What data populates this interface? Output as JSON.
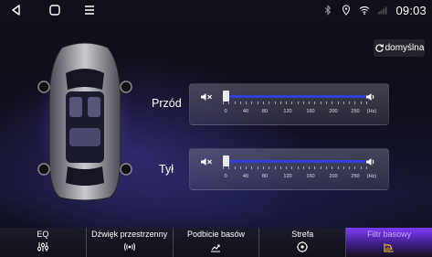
{
  "status_bar": {
    "nav": {
      "back_icon": "back-triangle-icon",
      "home_icon": "home-square-icon",
      "menu_icon": "menu-lines-icon"
    },
    "icons": [
      "bluetooth-icon",
      "location-pin-icon",
      "wifi-icon",
      "signal-icon"
    ],
    "time": "09:03"
  },
  "header": {
    "default_button": "domyślna"
  },
  "sliders": [
    {
      "label": "Przód",
      "value_hz": 0,
      "scale": [
        "0",
        "40",
        "80",
        "120",
        "160",
        "200",
        "250",
        "(Hz)"
      ]
    },
    {
      "label": "Tył",
      "value_hz": 0,
      "scale": [
        "0",
        "40",
        "80",
        "120",
        "160",
        "200",
        "250",
        "(Hz)"
      ]
    }
  ],
  "tabs": [
    {
      "label": "EQ",
      "icon": "equalizer-icon",
      "active": false
    },
    {
      "label": "Dźwięk przestrzenny",
      "icon": "surround-sound-icon",
      "active": false
    },
    {
      "label": "Podbicie basów",
      "icon": "bass-boost-icon",
      "active": false
    },
    {
      "label": "Strefa",
      "icon": "zone-target-icon",
      "active": false
    },
    {
      "label": "Filtr basowy",
      "icon": "bass-filter-icon",
      "active": true
    }
  ],
  "colors": {
    "accent": "#2f3fd8",
    "active_tab": "#7d3cff",
    "active_icon": "#f2c12e"
  }
}
